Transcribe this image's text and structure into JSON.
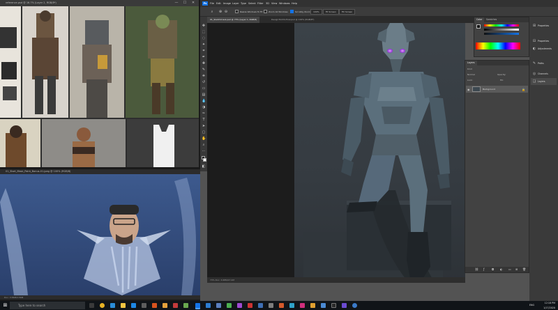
{
  "reference_window": {
    "title": "reference.psd @ 16.7% (Layer 2, RGB/8*)",
    "minimize": "—",
    "maximize": "☐",
    "close": "✕"
  },
  "webcam_window": {
    "title": "01_Start_Mask_Paint_Bonus-01.jpeg @ 100% (RGB/8)",
    "status": "Doc: 3.56M/3.56M"
  },
  "photoshop": {
    "logo": "Ps",
    "menu": [
      "File",
      "Edit",
      "Image",
      "Layer",
      "Type",
      "Select",
      "Filter",
      "3D",
      "View",
      "Windows",
      "Help"
    ],
    "options": {
      "resize_windows": "Resize Windows To Fit",
      "zoom_all_windows": "Zoom All Windows",
      "scrubby_zoom": "Scrubby Zoom",
      "zoom_value": "100%",
      "fit_screen": "Fit Screen",
      "fill_screen": "Fill Screen"
    },
    "tabs": [
      "01_Sketchmask.psd @ 73% (Layer 1, RGB/8)",
      "Design7b434-final.psd @ 100% (RGB/8*)"
    ],
    "status": "73%   Doc: 3.68M/27.2M",
    "color_panel": {
      "tabs": [
        "Color",
        "Swatches"
      ]
    },
    "layers_panel": {
      "title": "Layers",
      "filter_label": "Kind",
      "blend_mode": "Normal",
      "opacity_label": "Opacity:",
      "lock_label": "Lock:",
      "fill_label": "Fill:",
      "layer_name": "Background"
    },
    "side_panels": [
      {
        "label": "Properties",
        "icon": "⊟"
      },
      {
        "label": "Adjustments",
        "icon": "◐"
      },
      {
        "label": "Paths",
        "icon": "✎"
      },
      {
        "label": "Channels",
        "icon": "◎"
      },
      {
        "label": "Layers",
        "icon": "❏"
      }
    ],
    "side_panels_top": [
      {
        "label": "Properties",
        "icon": "⊞"
      }
    ]
  },
  "taskbar": {
    "search_placeholder": "Type here to search",
    "tray": {
      "lang": "ENG",
      "time": "12:18 PM",
      "date": "1/17/2020"
    }
  },
  "colors": {
    "ps_accent": "#1473e6",
    "canvas_bg": "#393f45",
    "armor": "#5b6f7c",
    "visor_glow": "#b845ff"
  }
}
